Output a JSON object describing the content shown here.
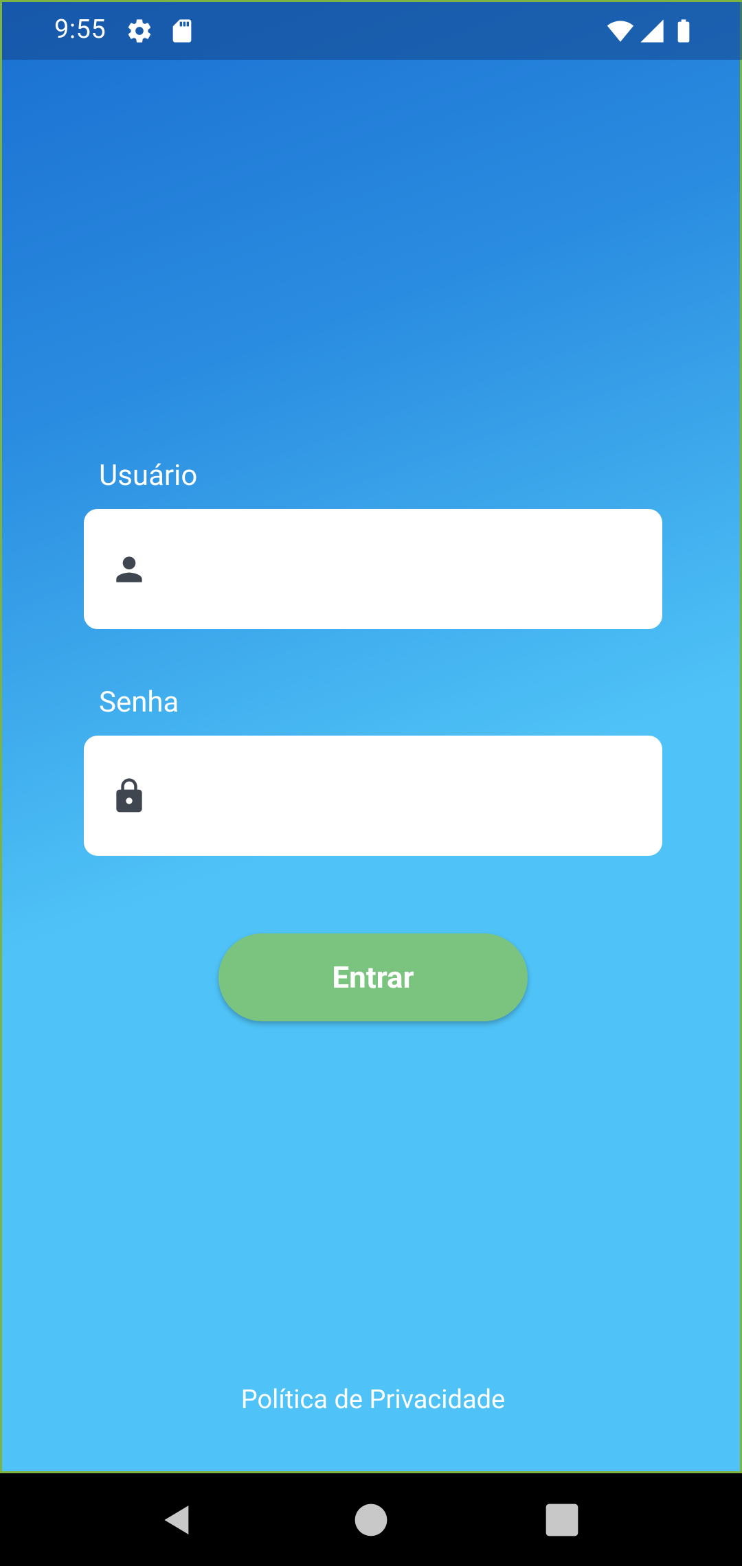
{
  "status_bar": {
    "time": "9:55",
    "icons": [
      "gear-icon",
      "sd-card-icon",
      "wifi-icon",
      "signal-icon",
      "battery-icon"
    ]
  },
  "login_form": {
    "username_label": "Usuário",
    "username_value": "",
    "username_icon": "person-icon",
    "password_label": "Senha",
    "password_value": "",
    "password_icon": "lock-icon",
    "submit_label": "Entrar"
  },
  "footer": {
    "privacy_link": "Política de Privacidade"
  },
  "navigation": {
    "buttons": [
      "back-icon",
      "home-icon",
      "recents-icon"
    ]
  },
  "colors": {
    "gradient_top": "#1a6fd0",
    "gradient_bottom": "#4fc3f7",
    "button": "#7bc47f",
    "icon": "#3f4650"
  }
}
